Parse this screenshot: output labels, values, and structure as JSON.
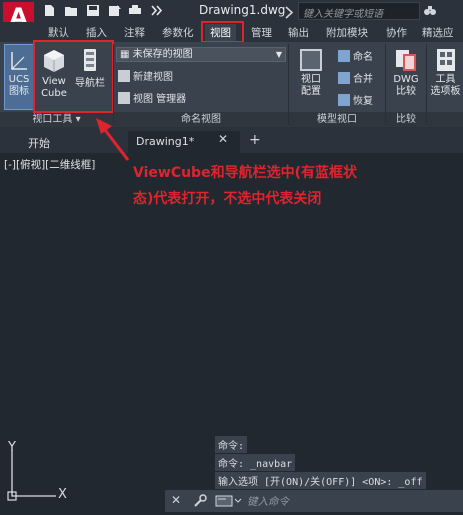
{
  "app": {
    "logo_letter": "A",
    "document_title": "Drawing1.dwg",
    "search_placeholder": "键入关键字或短语"
  },
  "ribbon_tabs": [
    "默认",
    "插入",
    "注释",
    "参数化",
    "视图",
    "管理",
    "输出",
    "附加模块",
    "协作",
    "精选应"
  ],
  "active_ribbon_tab": "视图",
  "ribbon": {
    "viewport_tools": {
      "ucs_label_1": "UCS",
      "ucs_label_2": "图标",
      "viewcube_label_1": "View",
      "viewcube_label_2": "Cube",
      "navbar_label": "导航栏",
      "panel_title": "视口工具"
    },
    "named_views": {
      "combo_value": "未保存的视图",
      "new_view": "新建视图",
      "view_manager": "视图 管理器",
      "panel_title": "命名视图"
    },
    "model_viewports": {
      "config_label_1": "视口",
      "config_label_2": "配置",
      "name_label": "命名",
      "join_label": "合并",
      "restore_label": "恢复",
      "panel_title": "模型视口"
    },
    "compare": {
      "dwg_label_1": "DWG",
      "dwg_label_2": "比较",
      "panel_title": "比较"
    },
    "palettes": {
      "tool_label_1": "工具",
      "tool_label_2": "选项板"
    }
  },
  "document_tabs": {
    "start": "开始",
    "drawing": "Drawing1*",
    "add": "+"
  },
  "viewport_label": "[-][俯视][二维线框]",
  "annotation": {
    "line1": "ViewCube和导航栏选中(有蓝框状",
    "line2": "态)代表打开，不选中代表关闭"
  },
  "ucs_axis": {
    "y": "Y",
    "x": "X"
  },
  "command_history": [
    "命令:",
    "命令: _navbar",
    "输入选项 [开(ON)/关(OFF)] <ON>: _off"
  ],
  "command_input_placeholder": "键入命令",
  "colors": {
    "accent_red": "#e0242e",
    "logo_red": "#c8102e",
    "ribbon_bg": "#3a434d",
    "canvas_bg": "#212830",
    "selected_blue": "#3d7bd6"
  }
}
